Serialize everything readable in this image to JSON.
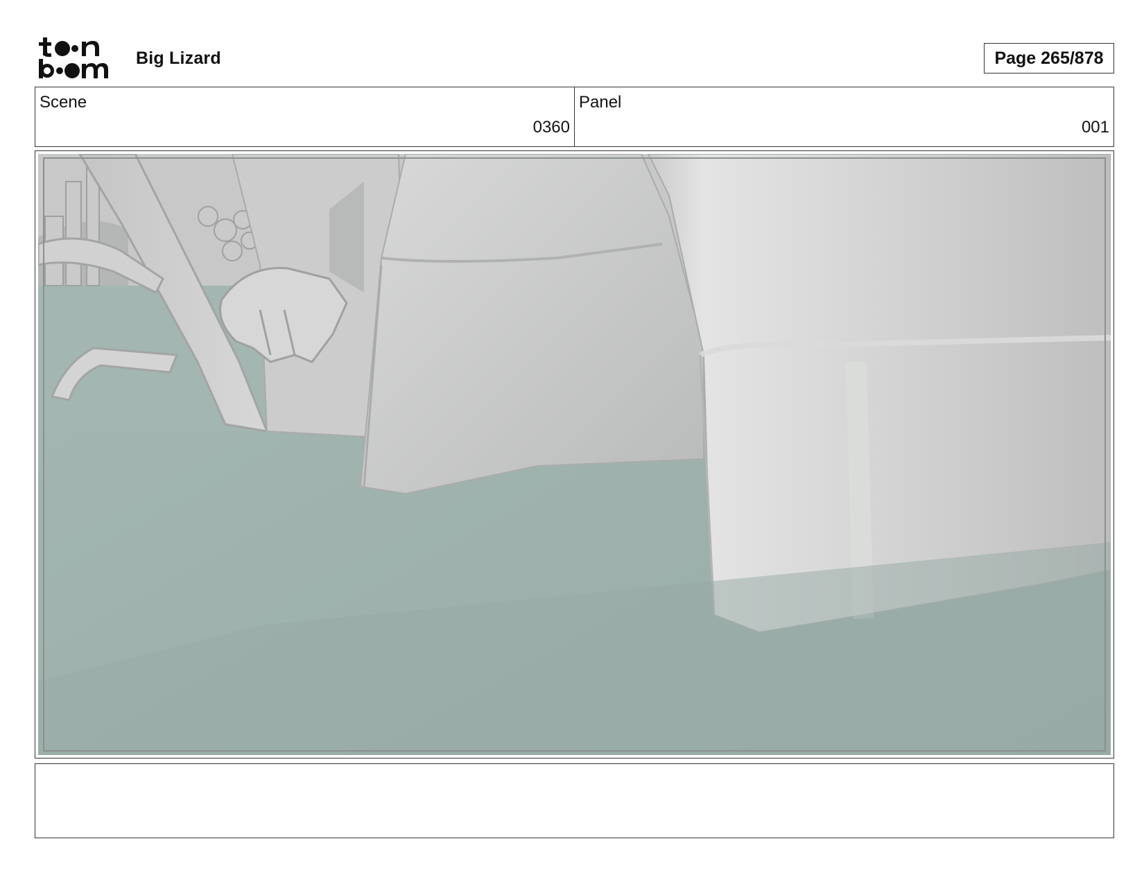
{
  "header": {
    "logo_icon": "toonboom-logo-icon",
    "project_title": "Big Lizard",
    "page_label": "Page 265/878"
  },
  "info": {
    "scene_label": "Scene",
    "scene_value": "0360",
    "panel_label": "Panel",
    "panel_value": "001"
  },
  "panel_image": {
    "icon": "storyboard-frame-image",
    "colors": {
      "ground": "#9fb2ae",
      "surface": "#d2d3d2",
      "shadow": "#a9acab",
      "highlight": "#e4e5e4"
    }
  },
  "notes": {
    "text": ""
  }
}
